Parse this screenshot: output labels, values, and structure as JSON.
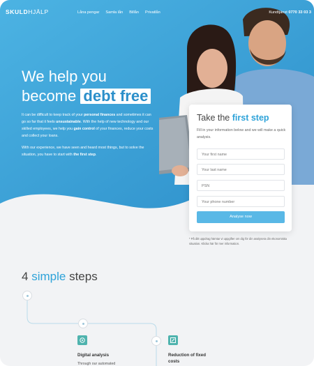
{
  "nav": {
    "logo_bold": "SKULD",
    "logo_light": "HJÄLP",
    "links": [
      "Låna pengar",
      "Samla lån",
      "Billån",
      "Privatlån"
    ],
    "contact_label": "Kundtjänst",
    "contact_phone": "0770 33 03 3"
  },
  "hero": {
    "headline_line1": "We help you",
    "headline_line2_prefix": "become",
    "headline_highlight": "debt free",
    "paragraph1": [
      {
        "t": "It can be difficult to keep track of your "
      },
      {
        "b": "personal finances"
      },
      {
        "t": " and sometimes it can go so far that it feels "
      },
      {
        "b": "unsustainable"
      },
      {
        "t": ". With the help of new technology and our skilled employees, we help you "
      },
      {
        "b": "gain control"
      },
      {
        "t": " of your finances, reduce your costs and collect your loans."
      }
    ],
    "paragraph2": [
      {
        "t": "With our experience, we have seen and heard most things, but to solve the situation, you have to start with "
      },
      {
        "b": "the first step"
      },
      {
        "t": "."
      }
    ]
  },
  "form": {
    "title_prefix": "Take the",
    "title_accent": "first step",
    "subtitle": "Fill in your information below and we will make a quick analysis.",
    "placeholders": [
      "Your first name",
      "Your last name",
      "PSN",
      "Your phone number"
    ],
    "submit_label": "Analyse now",
    "disclaimer": "* På ditt uppdrag hämtar vi uppgifter om dig för din analysera din ekonomiska situation. Klicka här för mer information."
  },
  "steps": {
    "title_number": "4",
    "title_accent": "simple",
    "title_suffix": "steps",
    "items": [
      {
        "label": "Digital analysis",
        "desc": "Through our automated"
      },
      {
        "label": "Reduction of fixed costs",
        "desc": ""
      }
    ]
  },
  "colors": {
    "hero_blue": "#3aa3d9",
    "accent": "#2ea3d9",
    "button": "#59b8e6",
    "step_icon": "#4fb3ae"
  }
}
